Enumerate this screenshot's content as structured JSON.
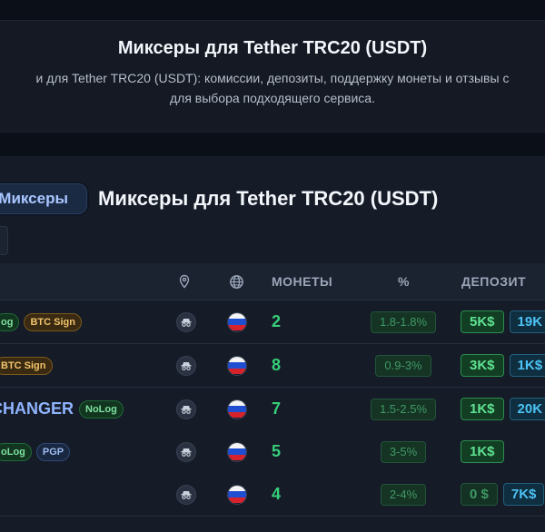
{
  "hero": {
    "title": "Миксеры для Tether TRC20 (USDT)",
    "desc_line1": "и для Tether TRC20 (USDT): комиссии, депозиты, поддержку монеты и отзывы с",
    "desc_line2": "для выбора подходящего сервиса."
  },
  "panel": {
    "tag": "Миксеры",
    "title": "Миксеры для Tether TRC20 (USDT)"
  },
  "table": {
    "headers": {
      "location_icon": "location-pin-icon",
      "web_icon": "globe-icon",
      "coins": "МОНЕТЫ",
      "percent": "%",
      "deposit": "ДЕПОЗИТ"
    },
    "rows": [
      {
        "name": "",
        "badges": [
          {
            "text": "og",
            "style": "green"
          },
          {
            "text": "BTC Sign",
            "style": "orange"
          }
        ],
        "coins": "2",
        "percent": "1.8-1.8%",
        "deposits": [
          "5K$",
          "19K"
        ],
        "dep_dim": false
      },
      {
        "name": "",
        "badges": [
          {
            "text": "BTC Sign",
            "style": "orange"
          }
        ],
        "coins": "8",
        "percent": "0.9-3%",
        "deposits": [
          "3K$",
          "1K$"
        ],
        "dep_dim": false
      },
      {
        "name": "CHANGER",
        "badges": [
          {
            "text": "NoLog",
            "style": "green"
          }
        ],
        "coins": "7",
        "percent": "1.5-2.5%",
        "deposits": [
          "1K$",
          "20K"
        ],
        "dep_dim": false
      },
      {
        "name": "",
        "badges": [
          {
            "text": "oLog",
            "style": "green"
          },
          {
            "text": "PGP",
            "style": "blue"
          }
        ],
        "coins": "5",
        "percent": "3-5%",
        "deposits": [
          "1K$"
        ],
        "dep_dim": false
      },
      {
        "name": "",
        "badges": [],
        "coins": "4",
        "percent": "2-4%",
        "deposits": [
          "0 $",
          "7K$"
        ],
        "dep_dim": true
      }
    ]
  },
  "colors": {
    "accent_green": "#37d07a",
    "accent_blue": "#4cc3f4",
    "name_blue": "#8fb4ff"
  }
}
